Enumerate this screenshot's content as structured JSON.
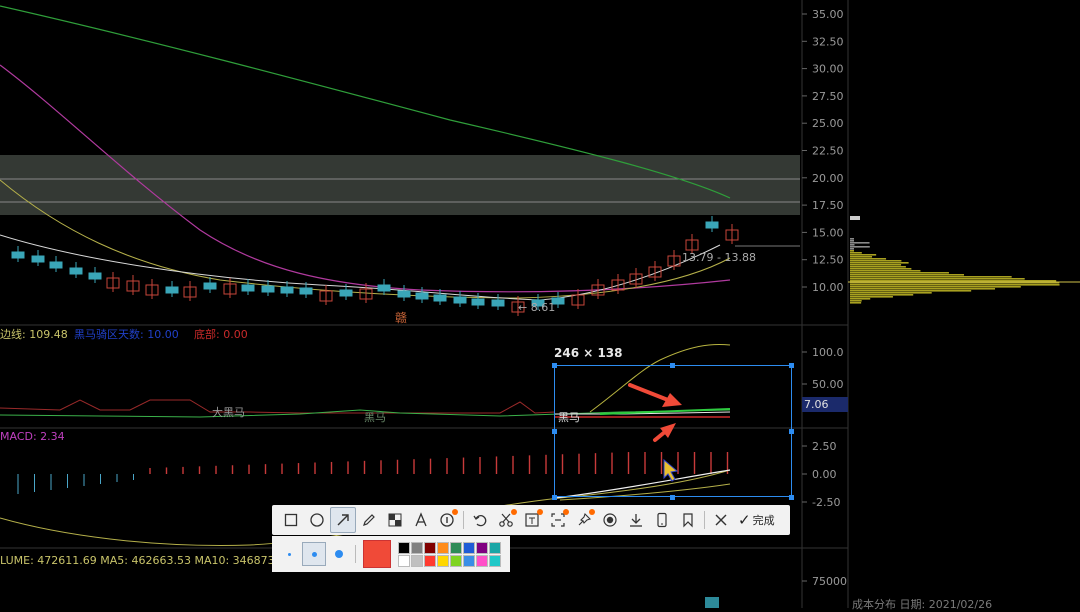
{
  "price_axis": [
    "35.00",
    "32.50",
    "30.00",
    "27.50",
    "25.00",
    "22.50",
    "20.00",
    "17.50",
    "15.00",
    "12.50",
    "10.00"
  ],
  "osc_axis": [
    "100.0",
    "50.00"
  ],
  "macd_axis": [
    "2.50",
    "0.00",
    "-2.50"
  ],
  "vol_axis": [
    "75000"
  ],
  "osc_value_badge": "7.06",
  "price_annotations": {
    "range": "13.79 - 13.88",
    "low": "← 8.61",
    "marker": "赣"
  },
  "indicator": {
    "line1_label": "边线: 109.48",
    "line2_label": "黑马骑区天数: 10.00",
    "line3_label": "底部: 0.00",
    "mark1": "大黑马",
    "mark2": "黑马",
    "mark3": "黑马"
  },
  "macd": {
    "label": "MACD: 2.34"
  },
  "volume": {
    "label": "LUME: 472611.69 MA5: 462663.53 MA10: 346873"
  },
  "cost_dist": {
    "label": "成本分布 日期: 2021/02/26"
  },
  "selection": {
    "size_label": "246 × 138"
  },
  "toolbar": {
    "items": [
      "rectangle-tool",
      "ellipse-tool",
      "arrow-tool",
      "pencil-tool",
      "mosaic-tool",
      "text-tool",
      "number-tool",
      "undo-tool",
      "cut-tool",
      "ocr-tool",
      "scroll-capture-tool",
      "pin-tool",
      "record-tool",
      "download-tool",
      "phone-tool",
      "bookmark-tool",
      "close-tool"
    ],
    "done_label": "完成"
  },
  "palette": {
    "current_color": "#f04a38",
    "colors_top": [
      "#000000",
      "#808080",
      "#800000",
      "#ff8c1a",
      "#2e8b57",
      "#1e5bd6",
      "#800080",
      "#1aa6a6"
    ],
    "colors_bottom": [
      "#ffffff",
      "#c0c0c0",
      "#ff3b30",
      "#ffd700",
      "#7fd321",
      "#3a8ee6",
      "#ff4fc8",
      "#20c8c8"
    ]
  }
}
